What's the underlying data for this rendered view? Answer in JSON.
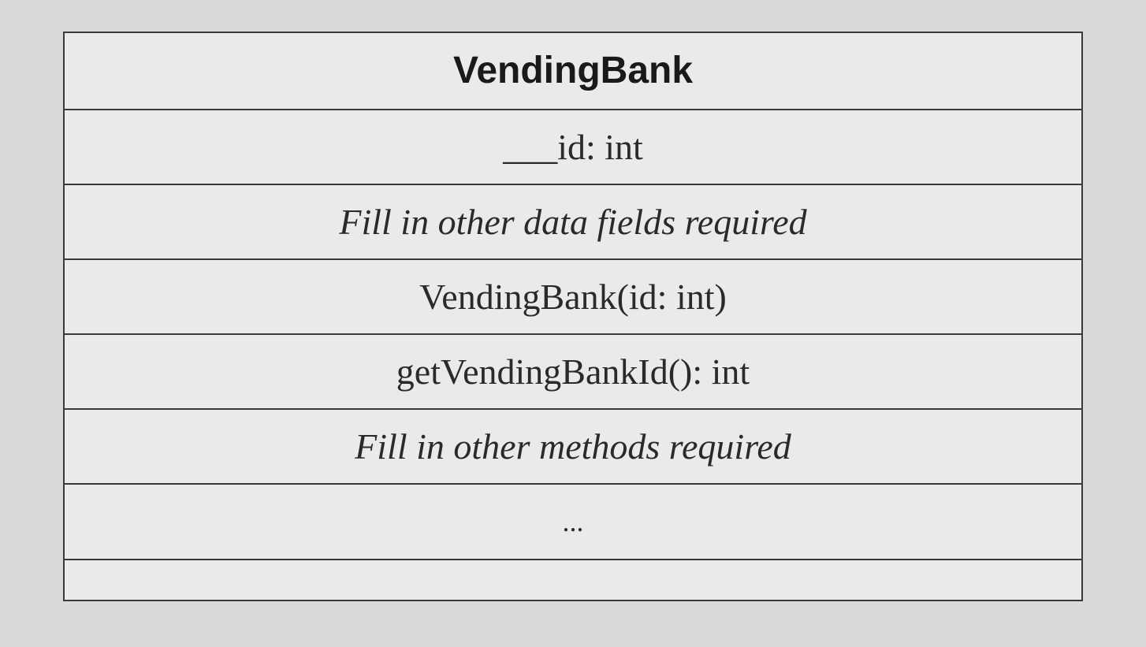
{
  "uml": {
    "className": "VendingBank",
    "attributes": [
      {
        "text": "___id: int",
        "italic": false
      },
      {
        "text": "Fill in other data fields required",
        "italic": true
      }
    ],
    "methods": [
      {
        "text": "VendingBank(id: int)",
        "italic": false
      },
      {
        "text": "getVendingBankId(): int",
        "italic": false
      },
      {
        "text": "Fill in other methods required",
        "italic": true
      }
    ],
    "ellipsis": "...",
    "empty": ""
  }
}
